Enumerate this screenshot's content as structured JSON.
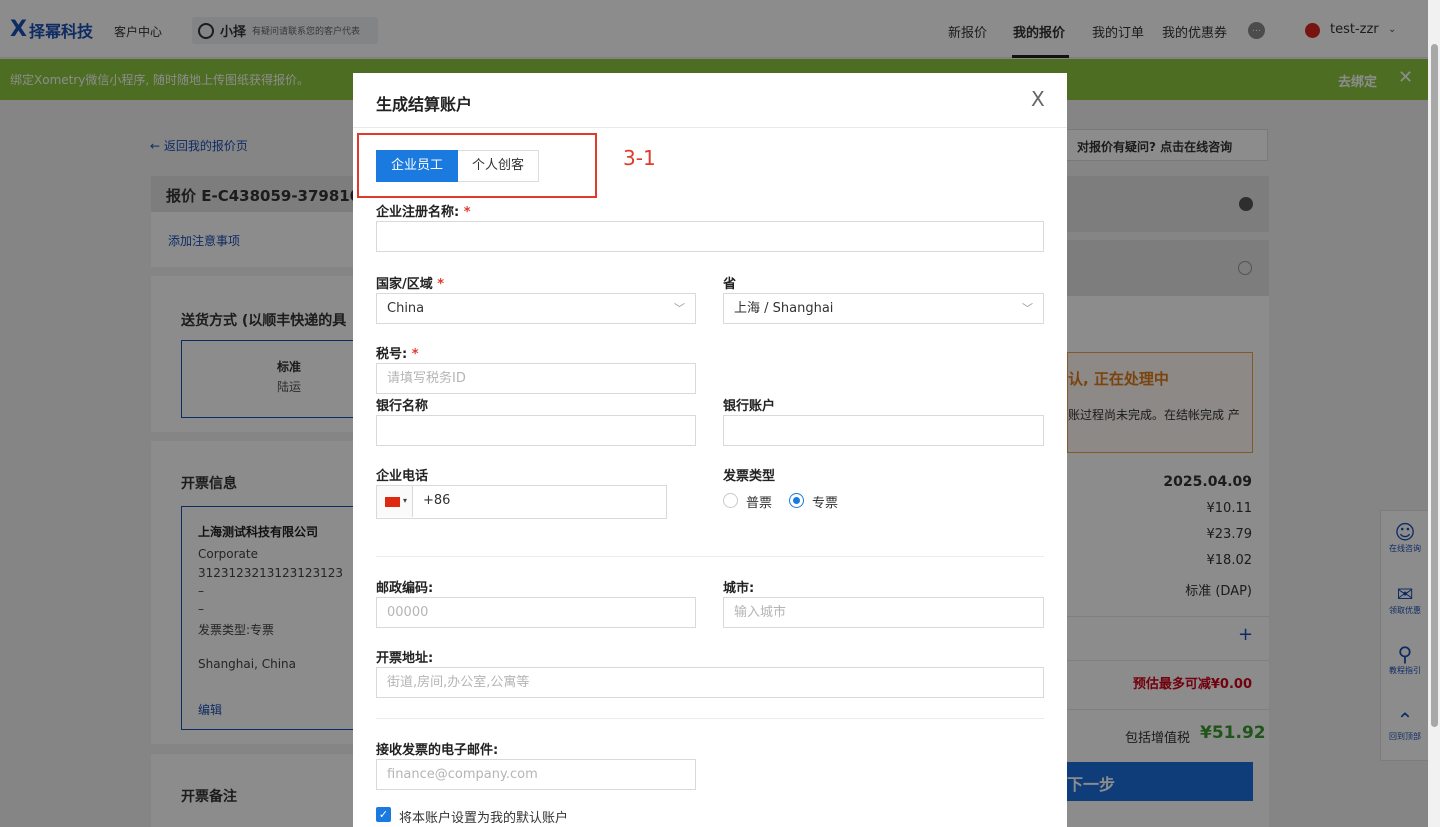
{
  "header": {
    "logo_mark": "X",
    "logo_name": "择幂科技",
    "customer_center": "客户中心",
    "rep_name": "小择",
    "rep_tagline": "有疑问请联系您的客户代表",
    "nav": [
      "新报价",
      "我的报价",
      "我的订单",
      "我的优惠券"
    ],
    "chat_glyph": "…",
    "user_name": "test-zzr",
    "user_caret": "⌄"
  },
  "banner": {
    "message": "绑定Xometry微信小程序, 随时随地上传图纸获得报价。",
    "bind_label": "去绑定",
    "close_glyph": "✕"
  },
  "left": {
    "back_link": "← 返回我的报价页",
    "quote_title": "报价 E-C438059-379810",
    "add_note": "添加注意事项",
    "shipping_title": "送货方式 (以顺丰快递的具",
    "shipping_option_name": "标准",
    "shipping_option_mode": "陆运",
    "invoice_title": "开票信息",
    "invoice_card": {
      "company": "上海测试科技有限公司",
      "type": "Corporate",
      "tax_id": "3123123213123123123",
      "line3": "–",
      "line4": "–",
      "invoice_type": "发票类型:专票",
      "location": "Shanghai, China",
      "edit": "编辑"
    },
    "memo_title": "开票备注"
  },
  "right": {
    "ask": "对报价有疑问? 点击在线咨询",
    "processing_title": "认, 正在处理中",
    "processing_desc": "账过程尚未完成。在结帐完成 产",
    "date": "2025.04.09",
    "amounts": [
      "¥10.11",
      "¥23.79",
      "¥18.02"
    ],
    "shipping_term": "标准 (DAP)",
    "plus": "+",
    "discount": "预估最多可减¥0.00",
    "vat_label": "包括增值税",
    "total": "¥51.92",
    "next": "下一步"
  },
  "side_tools": [
    {
      "icon": "☺",
      "label": "在线咨询"
    },
    {
      "icon": "✉",
      "label": "领取优惠"
    },
    {
      "icon": "⚲",
      "label": "教程指引"
    },
    {
      "icon": "⌃",
      "label": "回到顶部"
    }
  ],
  "modal": {
    "title": "生成结算账户",
    "close": "X",
    "tabs": [
      "企业员工",
      "个人创客"
    ],
    "annotation": "3-1",
    "company_name_label": "企业注册名称:",
    "country_label": "国家/区域",
    "country_value": "China",
    "province_label": "省",
    "province_value": "上海 / Shanghai",
    "tax_label": "税号:",
    "tax_placeholder": "请填写税务ID",
    "bank_name_label": "银行名称",
    "bank_account_label": "银行账户",
    "phone_label": "企业电话",
    "phone_code": "+86",
    "invoice_type_label": "发票类型",
    "invoice_types": [
      "普票",
      "专票"
    ],
    "invoice_type_selected": "专票",
    "postcode_label": "邮政编码:",
    "postcode_placeholder": "00000",
    "city_label": "城市:",
    "city_placeholder": "输入城市",
    "address_label": "开票地址:",
    "address_placeholder": "街道,房间,办公室,公寓等",
    "email_label": "接收发票的电子邮件:",
    "email_placeholder": "finance@company.com",
    "default_checkbox_label": "将本账户设置为我的默认账户",
    "required_mark": "*"
  }
}
